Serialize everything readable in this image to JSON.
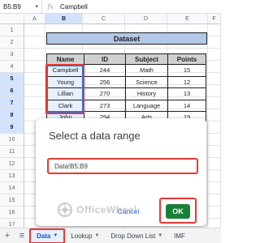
{
  "formula_bar": {
    "name_box": "B5:B9",
    "fx": "fx",
    "value": "Campbell"
  },
  "columns": [
    "A",
    "B",
    "C",
    "D",
    "E",
    "F"
  ],
  "rows": [
    "1",
    "2",
    "3",
    "4",
    "5",
    "6",
    "7",
    "8",
    "9",
    "10",
    "11",
    "12",
    "13",
    "14",
    "15",
    "16",
    "17"
  ],
  "table": {
    "title": "Dataset",
    "headers": [
      "Name",
      "ID",
      "Subject",
      "Points"
    ],
    "rows": [
      [
        "Campbell",
        "244",
        "Math",
        "15"
      ],
      [
        "Young",
        "256",
        "Science",
        "12"
      ],
      [
        "Lillian",
        "270",
        "History",
        "13"
      ],
      [
        "Clark",
        "273",
        "Language",
        "14"
      ],
      [
        "John",
        "294",
        "Arts",
        "19"
      ]
    ]
  },
  "dialog": {
    "title": "Select a data range",
    "range_value": "Data!B5:B9",
    "cancel_label": "Cancel",
    "ok_label": "OK"
  },
  "watermark": "OfficeWheel",
  "sheet_tabs": {
    "add_icon": "+",
    "menu_icon": "≡",
    "tabs": [
      {
        "label": "Data",
        "active": true
      },
      {
        "label": "Lookup",
        "active": false
      },
      {
        "label": "Drop Down List",
        "active": false
      },
      {
        "label": "IMF",
        "active": false
      }
    ]
  },
  "colors": {
    "accent": "#1a73e8",
    "highlight": "#e53935",
    "ok": "#188038",
    "title_fill": "#b4c7e7"
  }
}
